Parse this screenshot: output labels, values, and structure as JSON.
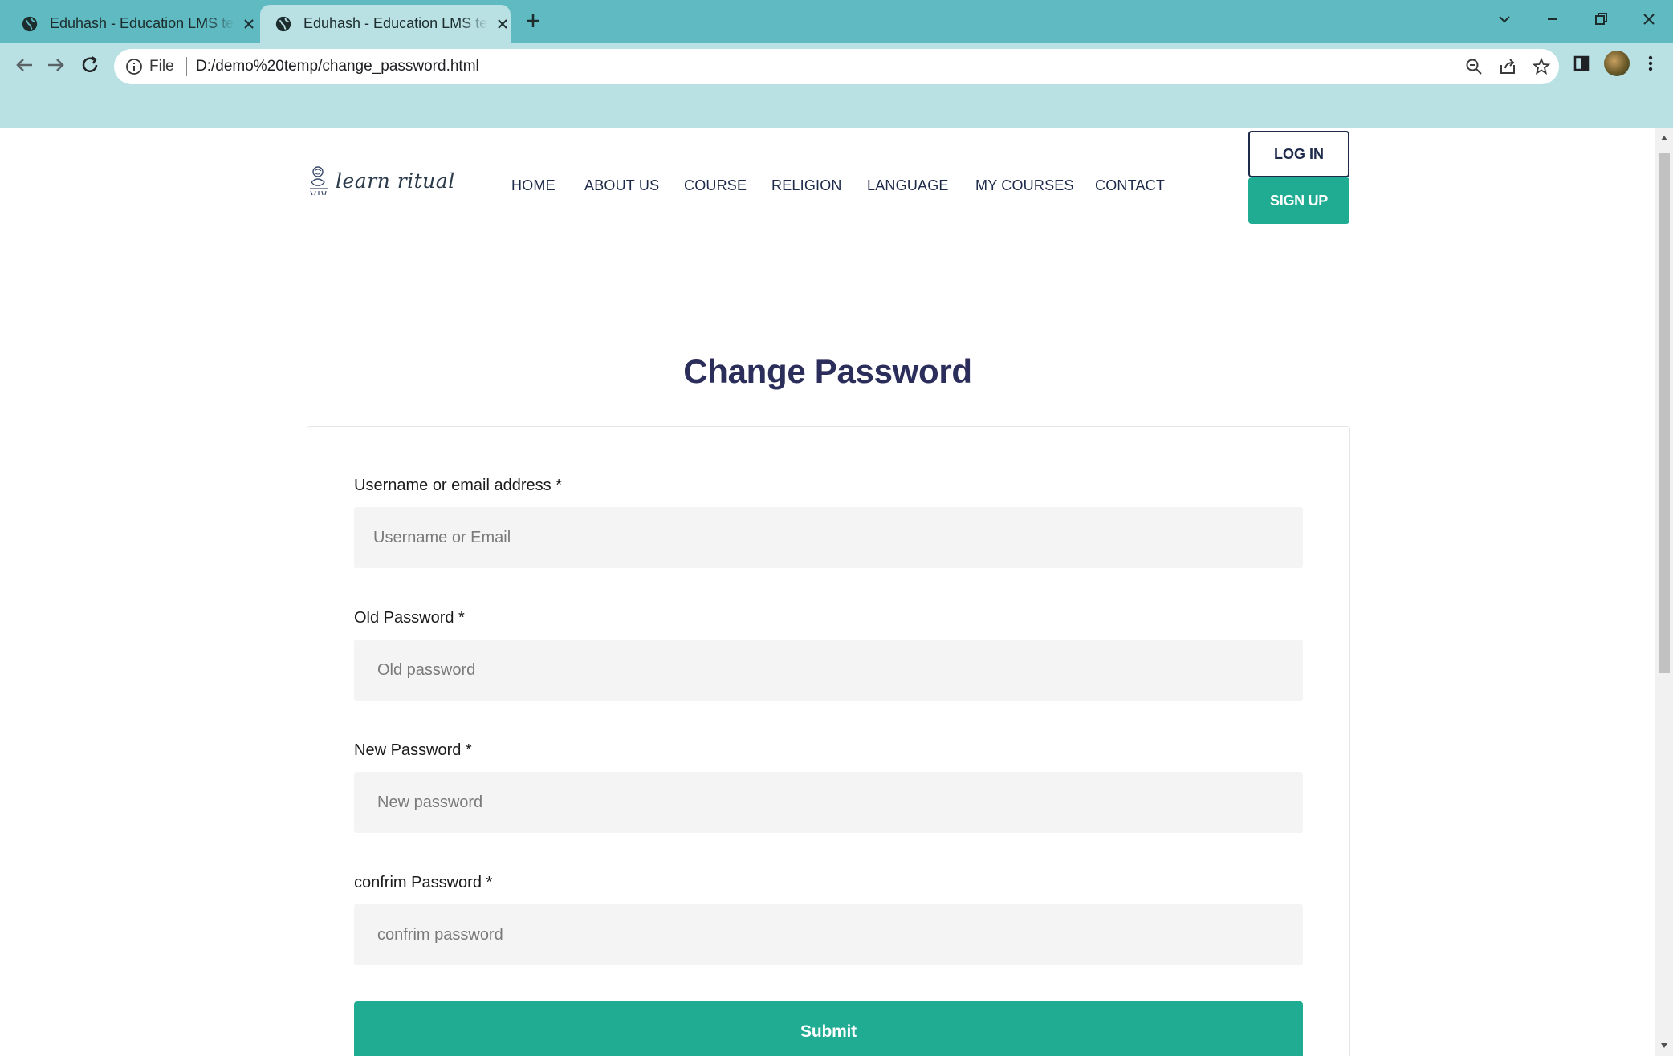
{
  "browser": {
    "tabs": [
      {
        "title": "Eduhash - Education LMS template",
        "active": false
      },
      {
        "title": "Eduhash - Education LMS template",
        "active": true
      }
    ],
    "address": {
      "scheme_label": "File",
      "url": "D:/demo%20temp/change_password.html"
    },
    "icons": [
      "globe-icon",
      "close-icon",
      "new-tab-icon",
      "back-icon",
      "forward-icon",
      "reload-icon",
      "info-icon",
      "zoom-icon",
      "share-icon",
      "star-icon",
      "side-panel-icon",
      "profile-avatar",
      "menu-kebab-icon",
      "tab-search-icon",
      "minimize-icon",
      "restore-icon",
      "window-close-icon"
    ]
  },
  "site": {
    "logo_text": "learn ritual",
    "nav": [
      {
        "label": "HOME"
      },
      {
        "label": "ABOUT US"
      },
      {
        "label": "COURSE"
      },
      {
        "label": "RELIGION"
      },
      {
        "label": "LANGUAGE"
      },
      {
        "label": "MY COURSES"
      },
      {
        "label": "CONTACT"
      }
    ],
    "login_label": "LOG IN",
    "signup_label": "SIGN UP",
    "colors": {
      "accent": "#1fac93",
      "heading": "#2b2e5a",
      "chrome_tab": "#5fbac1",
      "chrome_toolbar": "#b9e1e4"
    }
  },
  "form": {
    "title": "Change Password",
    "fields": [
      {
        "label": "Username or email address *",
        "placeholder": "Username or Email",
        "value": ""
      },
      {
        "label": "Old Password *",
        "placeholder": "Old password",
        "value": ""
      },
      {
        "label": "New Password *",
        "placeholder": "New password",
        "value": ""
      },
      {
        "label": "confrim Password *",
        "placeholder": "confrim password",
        "value": ""
      }
    ],
    "submit_label": "Submit"
  }
}
